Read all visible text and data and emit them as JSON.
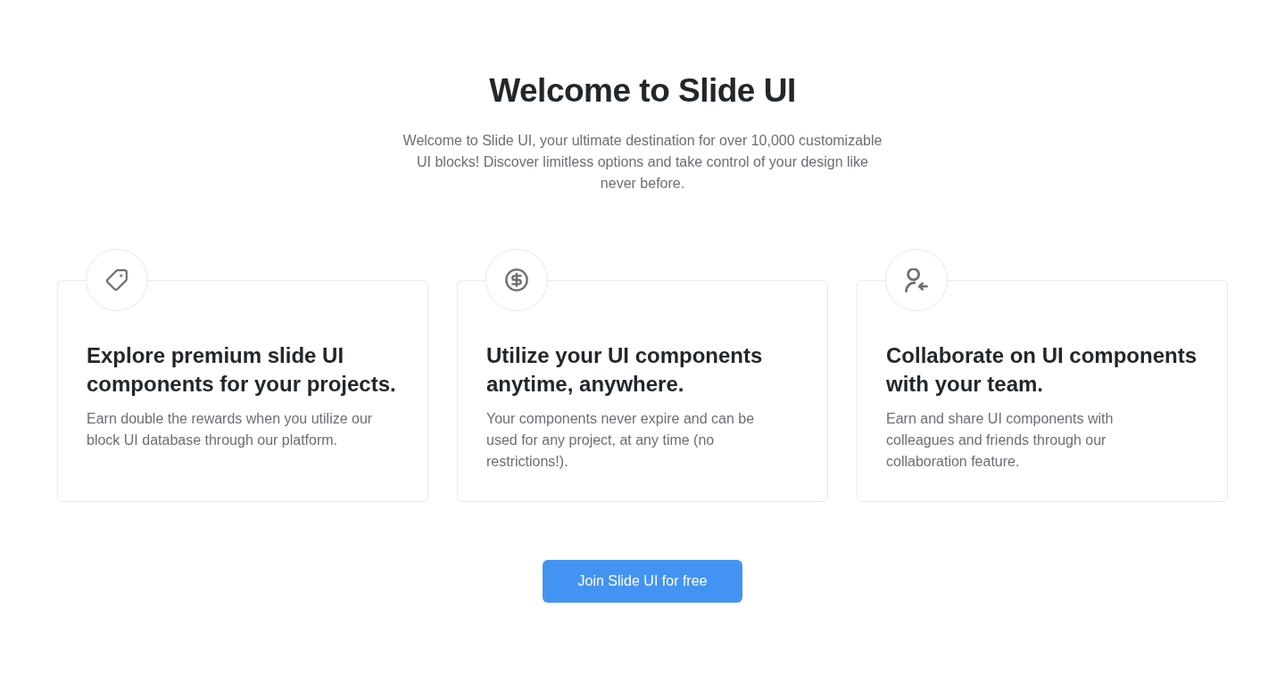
{
  "title": "Welcome to Slide UI",
  "subtitle": "Welcome to Slide UI, your ultimate destination for over 10,000 customizable UI blocks! Discover limitless options and take control of your design like never before.",
  "features": [
    {
      "title": "Explore premium slide UI components for your projects.",
      "description": "Earn double the rewards when you utilize our block UI database through our platform."
    },
    {
      "title": "Utilize your UI components anytime, anywhere.",
      "description": "Your components never expire and can be used for any project, at any time (no restrictions!)."
    },
    {
      "title": "Collaborate on UI components with your team.",
      "description": "Earn and share UI components with colleagues and friends through our collaboration feature."
    }
  ],
  "cta": {
    "label": "Join Slide UI for free"
  }
}
